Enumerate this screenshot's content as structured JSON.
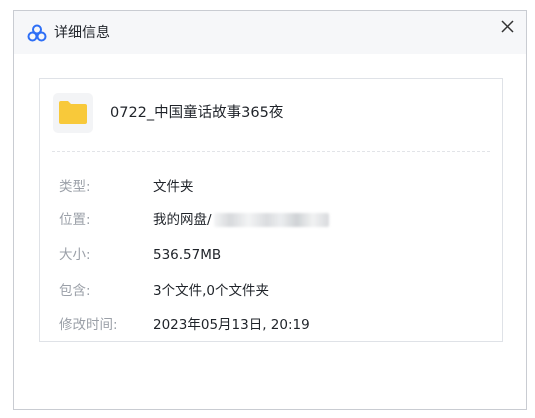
{
  "window": {
    "title": "详细信息"
  },
  "file": {
    "name": "0722_中国童话故事365夜"
  },
  "details": [
    {
      "label": "类型:",
      "value": "文件夹"
    },
    {
      "label": "位置:",
      "value": "我的网盘/"
    },
    {
      "label": "大小:",
      "value": "536.57MB"
    },
    {
      "label": "包含:",
      "value": "3个文件,0个文件夹"
    },
    {
      "label": "修改时间:",
      "value": "2023年05月13日, 20:19"
    }
  ],
  "colors": {
    "accent_blue": "#2e6ff6",
    "folder_yellow": "#f8c93a",
    "label_gray": "#9ba0a8",
    "text_dark": "#1f2329"
  }
}
